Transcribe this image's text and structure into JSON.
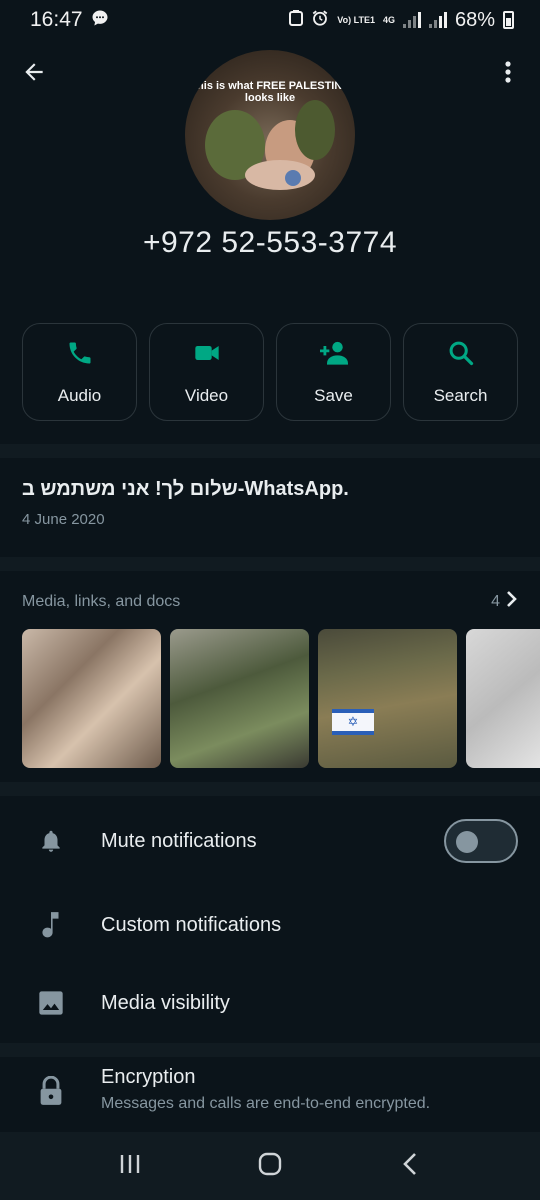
{
  "status_bar": {
    "time": "16:47",
    "battery": "68%",
    "network_label": "4G",
    "volte_label": "Vo) LTE1"
  },
  "contact": {
    "avatar_caption": "This is what FREE PALESTINE looks like",
    "phone": "+972 52-553-3774"
  },
  "actions": [
    {
      "label": "Audio",
      "icon": "phone-icon"
    },
    {
      "label": "Video",
      "icon": "video-camera-icon"
    },
    {
      "label": "Save",
      "icon": "add-contact-icon"
    },
    {
      "label": "Search",
      "icon": "search-icon"
    }
  ],
  "about": {
    "text": "שלום לך! אני משתמש ב-WhatsApp.",
    "date": "4 June 2020"
  },
  "media": {
    "title": "Media, links, and docs",
    "count": "4"
  },
  "settings": {
    "mute": "Mute notifications",
    "mute_enabled": false,
    "custom": "Custom notifications",
    "visibility": "Media visibility",
    "encryption": "Encryption",
    "encryption_sub": "Messages and calls are end-to-end encrypted."
  },
  "colors": {
    "background": "#0b141a",
    "accent": "#00a884",
    "muted_text": "#8696a0"
  }
}
